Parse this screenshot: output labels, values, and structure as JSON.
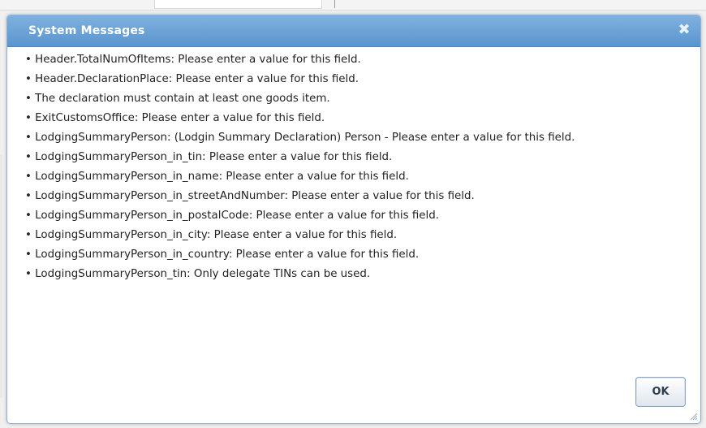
{
  "dialog": {
    "title": "System Messages",
    "close_label": "✖",
    "ok_label": "OK",
    "bullet": "•",
    "messages": [
      "Header.TotalNumOfItems: Please enter a value for this field.",
      "Header.DeclarationPlace: Please enter a value for this field.",
      "The declaration must contain at least one goods item.",
      "ExitCustomsOffice: Please enter a value for this field.",
      "LodgingSummaryPerson: (Lodgin Summary Declaration) Person - Please enter a value for this field.",
      "LodgingSummaryPerson_in_tin: Please enter a value for this field.",
      "LodgingSummaryPerson_in_name: Please enter a value for this field.",
      "LodgingSummaryPerson_in_streetAndNumber: Please enter a value for this field.",
      "LodgingSummaryPerson_in_postalCode: Please enter a value for this field.",
      "LodgingSummaryPerson_in_city: Please enter a value for this field.",
      "LodgingSummaryPerson_in_country: Please enter a value for this field.",
      "LodgingSummaryPerson_tin: Only delegate TINs can be used."
    ]
  }
}
